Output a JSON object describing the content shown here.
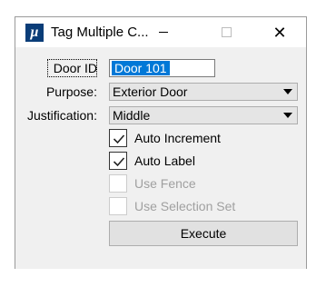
{
  "window": {
    "title": "Tag Multiple C...",
    "app_icon": "microstation-icon"
  },
  "form": {
    "door_id_label": "Door ID",
    "door_id_value": "Door 101",
    "purpose_label": "Purpose:",
    "purpose_value": "Exterior Door",
    "justification_label": "Justification:",
    "justification_value": "Middle"
  },
  "checkboxes": [
    {
      "label": "Auto Increment",
      "checked": true,
      "enabled": true
    },
    {
      "label": "Auto Label",
      "checked": true,
      "enabled": true
    },
    {
      "label": "Use Fence",
      "checked": false,
      "enabled": false
    },
    {
      "label": "Use Selection Set",
      "checked": false,
      "enabled": false
    }
  ],
  "execute_label": "Execute"
}
